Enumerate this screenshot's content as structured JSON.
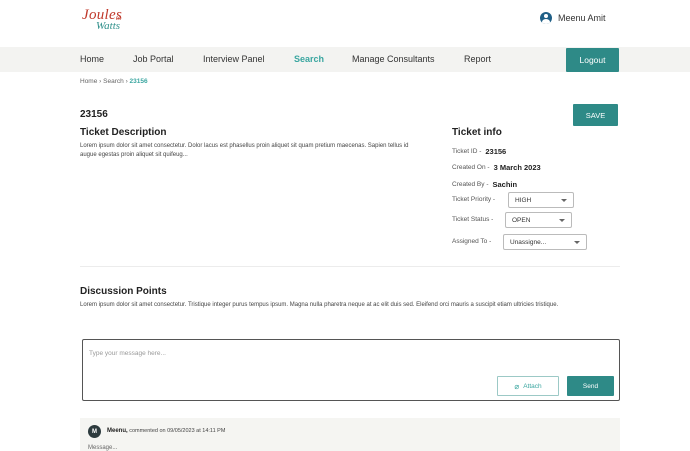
{
  "brand": {
    "logo_line1": "Joules",
    "logo_sup": "to",
    "logo_line2": "Watts"
  },
  "user": {
    "name": "Meenu Amit",
    "icon": "user-avatar-icon"
  },
  "nav": {
    "items": [
      {
        "label": "Home"
      },
      {
        "label": "Job Portal"
      },
      {
        "label": "Interview Panel"
      },
      {
        "label": "Search"
      },
      {
        "label": "Manage Consultants"
      },
      {
        "label": "Report"
      }
    ],
    "active": "Search",
    "logout_label": "Logout"
  },
  "breadcrumb": {
    "home": "Home",
    "sep": "›",
    "search": "Search",
    "current": "23156"
  },
  "ticket": {
    "id": "23156",
    "save_label": "SAVE",
    "description_title": "Ticket Description",
    "description": "Lorem ipsum dolor sit amet consectetur. Dolor lacus est phasellus proin aliquet sit quam pretium maecenas. Sapien tellus id augue egestas proin aliquet sit quifeug..."
  },
  "info": {
    "title": "Ticket info",
    "id_label": "Ticket ID -",
    "id_value": "23156",
    "created_on_label": "Created On -",
    "created_on_value": "3 March 2023",
    "created_by_label": "Created By -",
    "created_by_value": "Sachin",
    "priority_label": "Ticket Priority -",
    "priority_value": "HIGH",
    "status_label": "Ticket Status -",
    "status_value": "OPEN",
    "assigned_label": "Assigned To -",
    "assigned_value": "Unassigne..."
  },
  "discussion": {
    "title": "Discussion Points",
    "text": "Lorem ipsum dolor sit amet consectetur. Tristique integer purus tempus ipsum. Magna nulla pharetra neque at ac elit duis sed. Eleifend orci mauris a suscipit etiam ultricies tristique.",
    "placeholder": "Type your message here...",
    "attach_label": "Attach",
    "send_label": "Send"
  },
  "comment": {
    "avatar_initial": "M",
    "author": "Meenu,",
    "meta": "commented on 09/05/2023 at 14:11 PM",
    "body": "Message..."
  },
  "colors": {
    "accent": "#2e8a87",
    "accent_text": "#3aa6a0",
    "nav_bg": "#f3f3f1"
  }
}
